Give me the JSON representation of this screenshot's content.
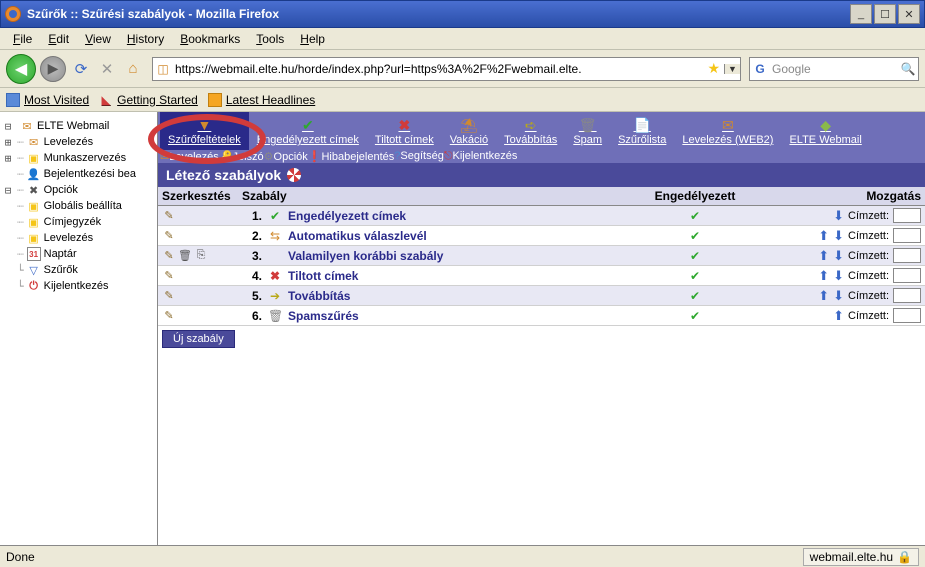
{
  "window": {
    "title": "Szűrők :: Szűrési szabályok - Mozilla Firefox"
  },
  "menu": {
    "file": "File",
    "edit": "Edit",
    "view": "View",
    "history": "History",
    "bookmarks": "Bookmarks",
    "tools": "Tools",
    "help": "Help"
  },
  "url": "https://webmail.elte.hu/horde/index.php?url=https%3A%2F%2Fwebmail.elte.",
  "search_placeholder": "Google",
  "bookmarks": {
    "most": "Most Visited",
    "start": "Getting Started",
    "latest": "Latest Headlines"
  },
  "toolbar1": [
    {
      "label": "Szűrőfeltételek",
      "icon": "funnel",
      "active": true
    },
    {
      "label": "Engedélyezett címek",
      "icon": "check"
    },
    {
      "label": "Tiltott címek",
      "icon": "x"
    },
    {
      "label": "Vakáció",
      "icon": "beach"
    },
    {
      "label": "Továbbítás",
      "icon": "arrow"
    },
    {
      "label": "Spam",
      "icon": "trash"
    },
    {
      "label": "Szűrőlista",
      "icon": "paper"
    },
    {
      "label": "Levelezés (WEB2)",
      "icon": "mail"
    },
    {
      "label": "ELTE Webmail",
      "icon": "elte"
    }
  ],
  "toolbar2": [
    {
      "label": "Levelezés",
      "icon": "mail"
    },
    {
      "label": "Jelszó",
      "icon": "key"
    },
    {
      "label": "Opciók",
      "icon": "gear"
    },
    {
      "label": "Hibabejelentés",
      "icon": "excl"
    },
    {
      "label": "Segítség",
      "icon": "q"
    },
    {
      "label": "Kijelentkezés",
      "icon": "out"
    }
  ],
  "tree": [
    {
      "ind": "⊟",
      "dots": "",
      "icon": "env",
      "label": "ELTE Webmail"
    },
    {
      "ind": "⊞",
      "dots": "┈",
      "icon": "mail",
      "label": "Levelezés"
    },
    {
      "ind": "⊞",
      "dots": "┈",
      "icon": "folder",
      "label": "Munkaszervezés"
    },
    {
      "ind": "",
      "dots": "┈",
      "icon": "person",
      "label": "Bejelentkezési bea"
    },
    {
      "ind": "⊟",
      "dots": "┈",
      "icon": "gear",
      "label": "Opciók"
    },
    {
      "ind": "",
      "dots": "  ┈",
      "icon": "folder",
      "label": "Globális beállíta"
    },
    {
      "ind": "",
      "dots": "  ┈",
      "icon": "folder",
      "label": "Címjegyzék"
    },
    {
      "ind": "",
      "dots": "  ┈",
      "icon": "folder",
      "label": "Levelezés"
    },
    {
      "ind": "",
      "dots": "  ┈",
      "icon": "cal",
      "label": "Naptár",
      "calnum": "31"
    },
    {
      "ind": "",
      "dots": "  └",
      "icon": "funnel",
      "label": "Szűrők"
    },
    {
      "ind": "",
      "dots": "└",
      "icon": "logout",
      "label": "Kijelentkezés"
    }
  ],
  "panel_title": "Létező szabályok",
  "cols": {
    "edit": "Szerkesztés",
    "rule": "Szabály",
    "enabled": "Engedélyezett",
    "move": "Mozgatás"
  },
  "rules": [
    {
      "num": "1.",
      "icon": "✔",
      "iconcls": "ic-check",
      "name": "Engedélyezett címek",
      "edit": [
        "pencil"
      ],
      "up": false,
      "down": true
    },
    {
      "num": "2.",
      "icon": "⇆",
      "iconcls": "ic-beach",
      "name": "Automatikus válaszlevél",
      "edit": [
        "pencil"
      ],
      "up": true,
      "down": true
    },
    {
      "num": "3.",
      "icon": "",
      "iconcls": "",
      "name": "Valamilyen korábbi szabály",
      "edit": [
        "pencil",
        "trash",
        "copy"
      ],
      "up": true,
      "down": true
    },
    {
      "num": "4.",
      "icon": "✖",
      "iconcls": "ic-x",
      "name": "Tiltott címek",
      "edit": [
        "pencil"
      ],
      "up": true,
      "down": true
    },
    {
      "num": "5.",
      "icon": "➔",
      "iconcls": "ic-arrow",
      "name": "Továbbítás",
      "edit": [
        "pencil"
      ],
      "up": true,
      "down": true
    },
    {
      "num": "6.",
      "icon": "🗑",
      "iconcls": "ic-trash",
      "name": "Spamszűrés",
      "edit": [
        "pencil"
      ],
      "up": true,
      "down": false
    }
  ],
  "move_label": "Címzett:",
  "new_rule": "Új szabály",
  "status_left": "Done",
  "status_right": "webmail.elte.hu"
}
